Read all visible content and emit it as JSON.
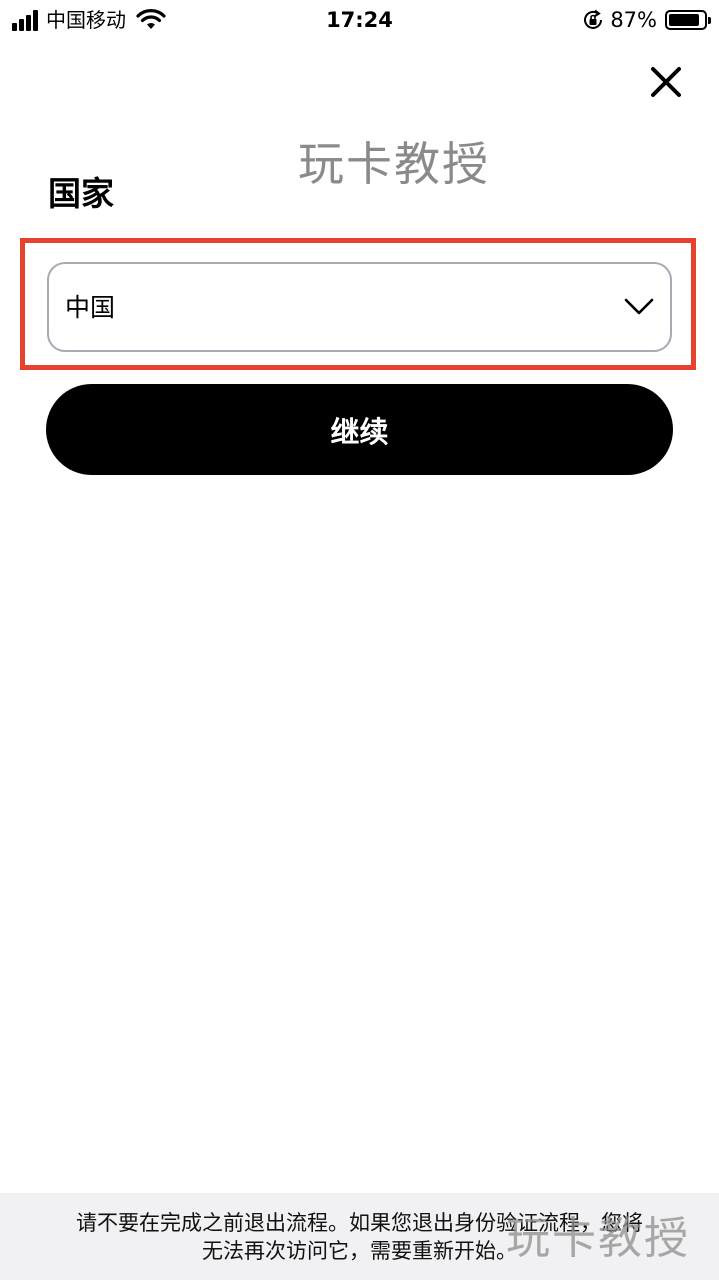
{
  "status_bar": {
    "carrier": "中国移动",
    "time": "17:24",
    "battery_percent": "87%",
    "battery_level": 0.87,
    "icons": [
      "signal-icon",
      "wifi-icon",
      "orientation-lock-icon",
      "battery-icon"
    ]
  },
  "watermark": {
    "top": "玩卡教授",
    "bottom": "玩卡教授"
  },
  "form": {
    "country_label": "国家",
    "country_value": "中国",
    "continue_label": "继续"
  },
  "footer": {
    "notice_line1": "请不要在完成之前退出流程。如果您退出身份验证流程，您将",
    "notice_line2": "无法再次访问它，需要重新开始。"
  },
  "colors": {
    "highlight": "#e5432e",
    "button_bg": "#000000",
    "footer_bg": "#f1f1f3",
    "select_border": "#a9a9b4"
  }
}
